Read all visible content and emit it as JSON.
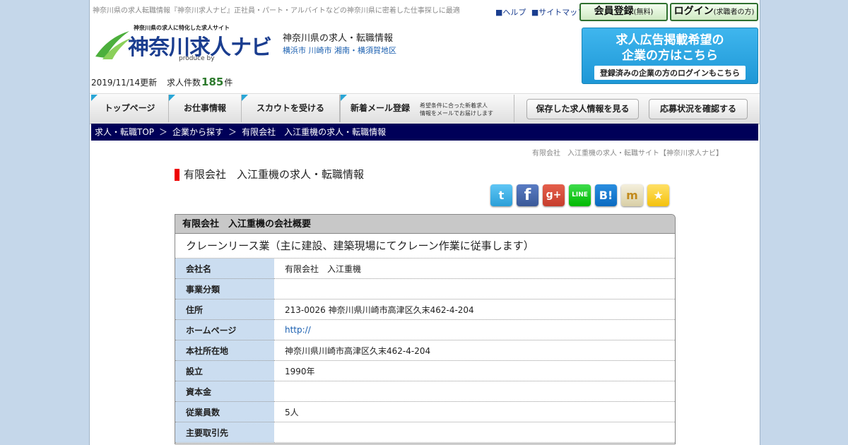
{
  "header": {
    "tagline": "神奈川県の求人転職情報『神奈川求人ナビ』正社員・パート・アルバイトなどの神奈川県に密着した仕事探しに最適",
    "help_link": "■ヘルプ",
    "sitemap_link": "■サイトマップ",
    "register_button": "会員登録",
    "register_note": "(無料)",
    "login_button": "ログイン",
    "login_note": "(求職者の方)",
    "logo_tagline": "神奈川県の求人に特化した求人サイト",
    "logo_text": "神奈川求人ナビ",
    "logo_produce": "produce by",
    "site_description": "神奈川県の求人・転職情報",
    "site_areas": "横浜市 川崎市 湘南・横須賀地区",
    "banner_line1": "求人広告掲載希望の",
    "banner_line2": "企業の方はこちら",
    "banner_login": "登録済みの企業の方のログインもこちら",
    "update_date": "2019/11/14更新",
    "count_label": "求人件数",
    "count_value": "185",
    "count_unit": "件"
  },
  "nav": {
    "top": "トップページ",
    "jobs": "お仕事情報",
    "scout": "スカウトを受ける",
    "mail": "新着メール登録",
    "mail_sub1": "希望条件に合った新着求人",
    "mail_sub2": "情報をメールでお届けします",
    "saved": "保存した求人情報を見る",
    "status": "応募状況を確認する"
  },
  "breadcrumb": {
    "items": [
      "求人・転職TOP",
      "企業から探す",
      "有限会社　入江重機の求人・転職情報"
    ],
    "separator": "＞"
  },
  "page": {
    "subtitle": "有限会社　入江重機の求人・転職サイト【神奈川求人ナビ】",
    "title": "有限会社　入江重機の求人・転職情報"
  },
  "share": {
    "twitter": "twitter-icon",
    "facebook": "facebook-icon",
    "googleplus": "google-plus-icon",
    "line": "line-icon",
    "hatena": "hatena-bookmark-icon",
    "mixi": "mixi-icon",
    "favorite": "star-icon",
    "googleplus_text": "g+",
    "line_text": "LINE",
    "hatena_text": "B!",
    "mixi_text": "m",
    "star_text": "★",
    "facebook_text": "f",
    "twitter_text": "t"
  },
  "company": {
    "box_title": "有限会社　入江重機の会社概要",
    "catchphrase": "クレーンリース業（主に建設、建築現場にてクレーン作業に従事します）",
    "rows": [
      {
        "label": "会社名",
        "value": "有限会社　入江重機"
      },
      {
        "label": "事業分類",
        "value": ""
      },
      {
        "label": "住所",
        "value": "213-0026 神奈川県川崎市高津区久末462-4-204"
      },
      {
        "label": "ホームページ",
        "value": "http://"
      },
      {
        "label": "本社所在地",
        "value": "神奈川県川崎市高津区久末462-4-204"
      },
      {
        "label": "設立",
        "value": "1990年"
      },
      {
        "label": "資本金",
        "value": ""
      },
      {
        "label": "従業員数",
        "value": "5人"
      },
      {
        "label": "主要取引先",
        "value": ""
      }
    ]
  },
  "colors": {
    "background": "#c5d7ea",
    "breadcrumb_bg": "#000058",
    "accent_red": "#ee0000",
    "table_key_bg": "#cbddf0",
    "count_green": "#2d7a2d"
  }
}
